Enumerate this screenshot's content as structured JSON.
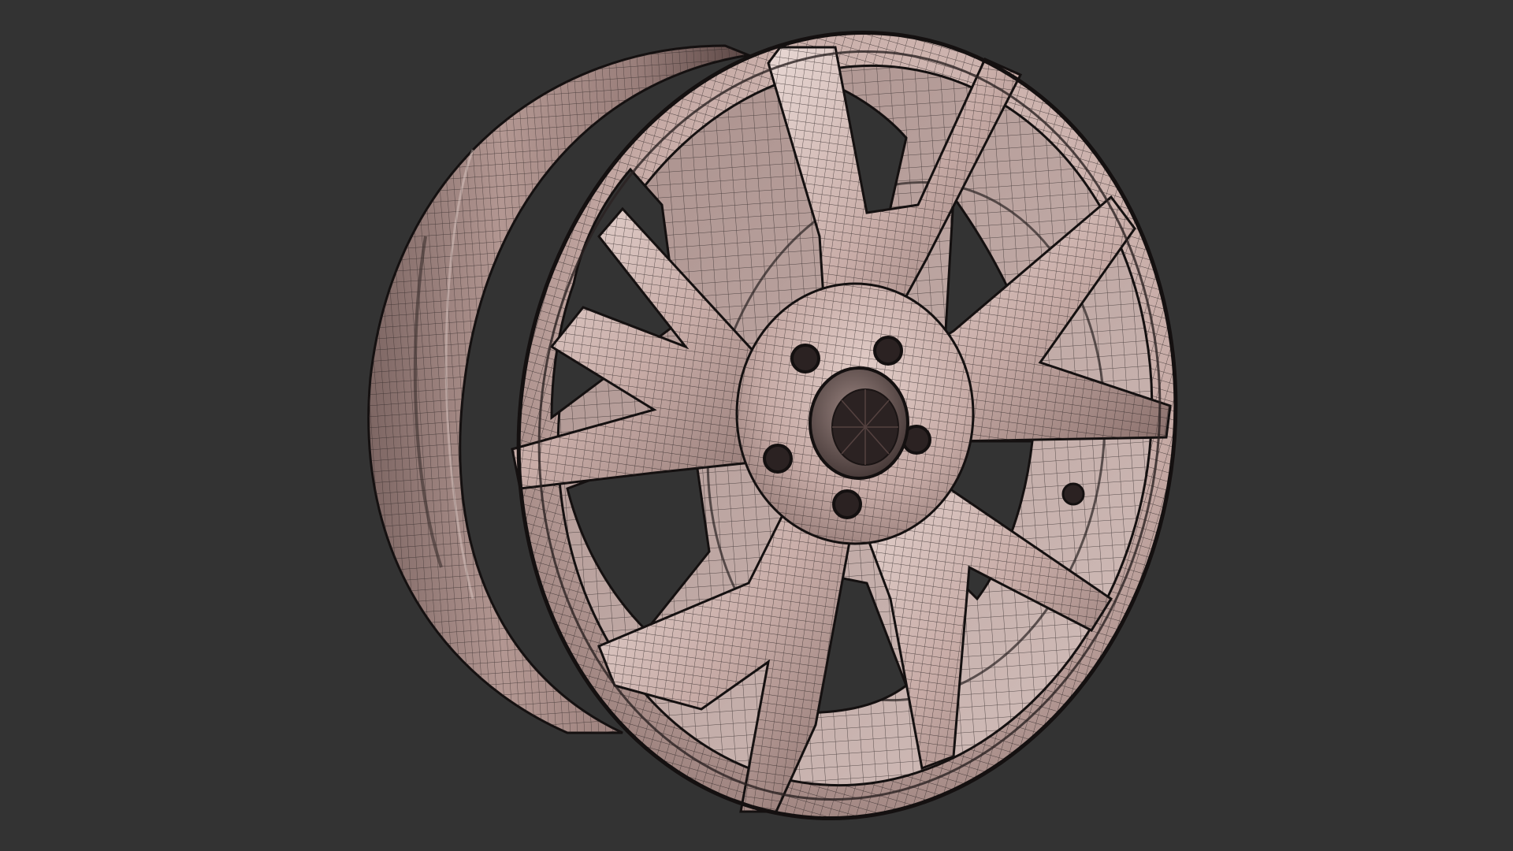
{
  "viewport": {
    "background": "#333333",
    "subject": "wheel-rim",
    "render_mode": "wireframe",
    "spoke_count": 5,
    "lug_hole_count": 5,
    "colors": {
      "surface": "#c4a8a3",
      "surface_light": "#e6d3cf",
      "surface_dark": "#6b5553",
      "mesh_line": "#2a2222",
      "outline": "#141010",
      "cavity": "#333333"
    }
  }
}
